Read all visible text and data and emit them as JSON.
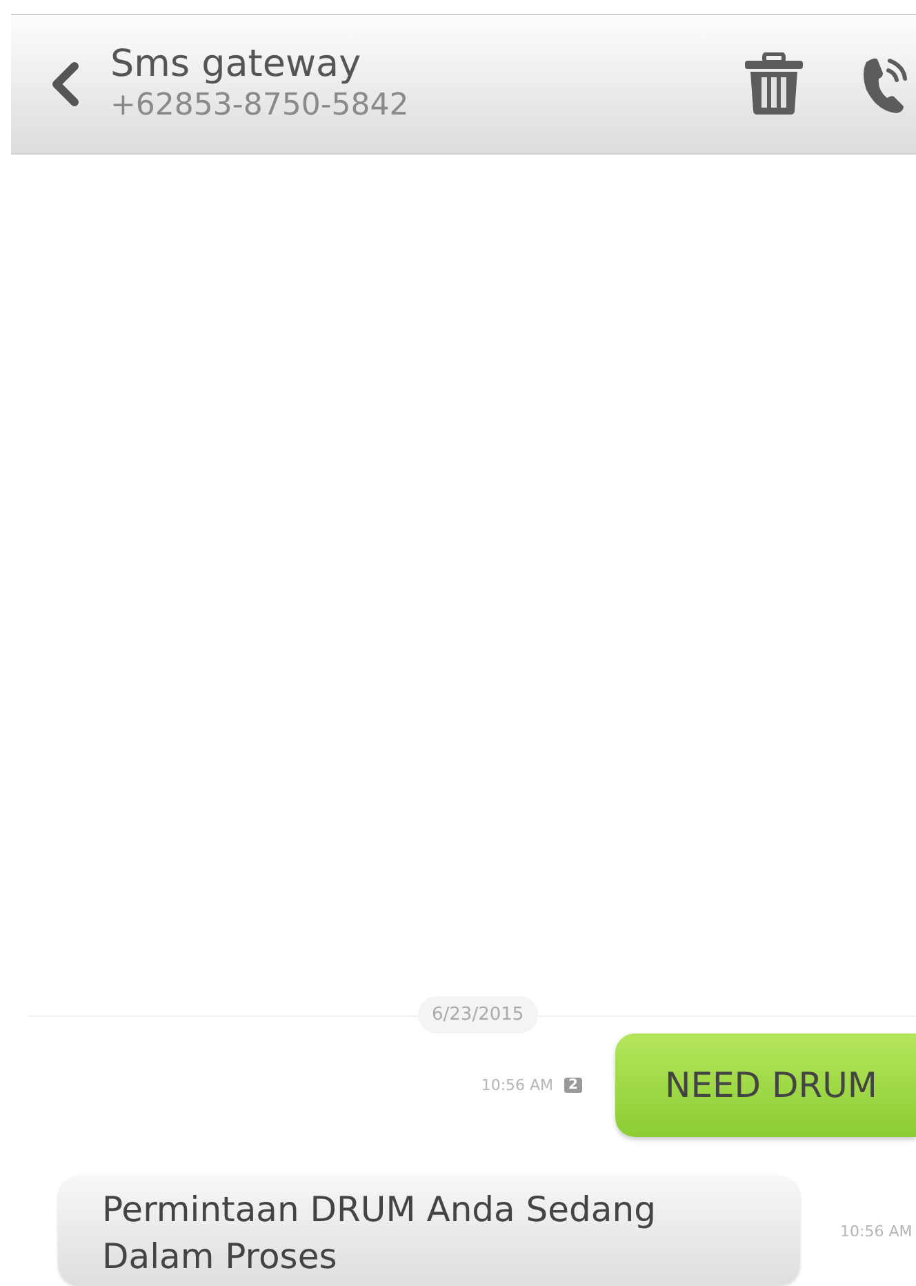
{
  "header": {
    "title": "Sms gateway",
    "subtitle": "+62853-8750-5842"
  },
  "thread": {
    "date": "6/23/2015",
    "messages": [
      {
        "kind": "sent",
        "text": "NEED DRUM",
        "time": "10:56 AM",
        "sim": "2"
      },
      {
        "kind": "received",
        "text": "Permintaan DRUM Anda Sedang Dalam Proses",
        "time": "10:56 AM"
      }
    ]
  }
}
